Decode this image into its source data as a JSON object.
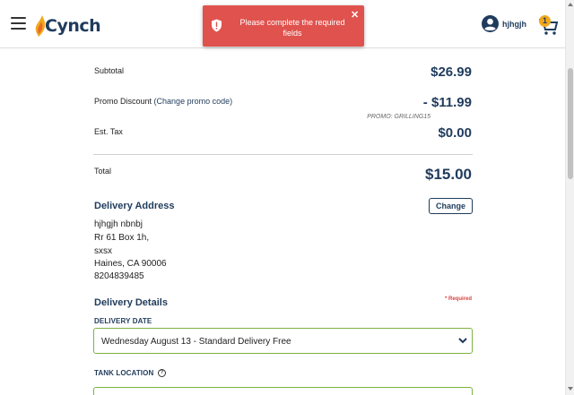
{
  "header": {
    "logo_text": "Cynch",
    "user_name": "hjhgjh",
    "cart_count": "1"
  },
  "toast": {
    "message": "Please complete the required fields",
    "close_label": "✕"
  },
  "summary": {
    "subtotal_label": "Subtotal",
    "subtotal_value": "$26.99",
    "promo_label": "Promo Discount",
    "promo_change_link": "(Change promo code)",
    "promo_value": "- $11.99",
    "promo_code_note": "PROMO: GRILLING15",
    "tax_label": "Est. Tax",
    "tax_value": "$0.00",
    "total_label": "Total",
    "total_value": "$15.00"
  },
  "delivery_address": {
    "title": "Delivery Address",
    "change_label": "Change",
    "lines": [
      "hjhgjh nbnbj",
      "Rr 61 Box 1h,",
      "sxsx",
      "Haines, CA 90006",
      "8204839485"
    ]
  },
  "delivery_details": {
    "title": "Delivery Details",
    "required_note": "* Required",
    "date_label": "DELIVERY DATE",
    "date_value": "Wednesday August 13 - Standard Delivery Free",
    "tank_label": "TANK LOCATION",
    "help_glyph": "?"
  },
  "colors": {
    "brand_navy": "#1f3b5c",
    "brand_orange": "#f2a81d",
    "toast_red": "#e0524d",
    "field_green": "#7cb342",
    "required_red": "#d9443f"
  },
  "icons": [
    "menu-icon",
    "flame-logo-icon",
    "user-icon",
    "cart-icon",
    "shield-alert-icon",
    "close-icon",
    "chevron-down-icon",
    "help-icon"
  ]
}
